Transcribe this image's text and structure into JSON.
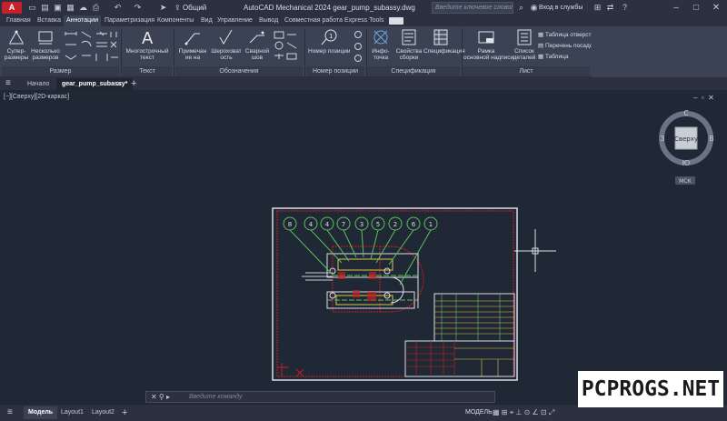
{
  "titlebar": {
    "app_button": "A",
    "share_label": "Общий доступ",
    "title": "AutoCAD Mechanical 2024    gear_pump_subassy.dwg",
    "search_placeholder": "Введите ключевое слово/фразу",
    "signin_label": "Вход в службы"
  },
  "ribbon_tabs": [
    "Главная",
    "Вставка",
    "Аннотации",
    "Параметризация",
    "Компоненты",
    "Вид",
    "Управление",
    "Вывод",
    "Совместная работа",
    "Express Tools"
  ],
  "ribbon": {
    "panels": {
      "dimension": "Размер",
      "text": "Текст",
      "annotation": "Обозначения",
      "balloon": "Номер позиции",
      "spec": "Спецификация",
      "sheet": "Лист"
    },
    "buttons": {
      "super_dim": "Супер-\nразмеры",
      "multi_dim": "Несколько\nразмеров",
      "mtext": "Многострочный\nтекст",
      "note": "Примечан\nие на",
      "roughness": "Шероховат\nость",
      "weld": "Сварной\nшов",
      "balloon": "Номер позиции",
      "info": "Инфо-\nточка",
      "assembly_props": "Свойства\nсборки",
      "spec": "Спецификация",
      "title_block": "Рамка\nосновной надписи",
      "detail_list": "Список\nдеталей",
      "hole_table": "Таблица отверстий",
      "list_fits": "Перечень посадок",
      "table": "Таблица"
    }
  },
  "doc_tabs": [
    "Начало",
    "gear_pump_subassy*"
  ],
  "viewport_label": "[−][Сверху][2D-каркас]",
  "viewcube": {
    "face": "Сверху",
    "north": "С",
    "south": "Ю",
    "east": "В",
    "west": "З",
    "wcs": "МСК"
  },
  "balloons": [
    "8",
    "4",
    "4",
    "7",
    "3",
    "5",
    "2",
    "6",
    "1"
  ],
  "command_placeholder": "Введите команду",
  "status_tabs": [
    "Модель",
    "Layout1",
    "Layout2"
  ],
  "status_mode": "МОДЕЛЬ",
  "watermark": "PCPROGS.NET"
}
